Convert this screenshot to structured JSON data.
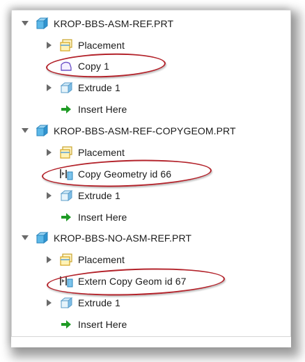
{
  "tree": {
    "parts": [
      {
        "name": "KROP-BBS-ASM-REF.PRT",
        "children": [
          {
            "label": "Placement",
            "icon": "placement-icon"
          },
          {
            "label": "Copy 1",
            "icon": "copy-icon"
          },
          {
            "label": "Extrude 1",
            "icon": "extrude-icon"
          },
          {
            "label": "Insert Here",
            "icon": "insert-here-arrow-icon"
          }
        ]
      },
      {
        "name": "KROP-BBS-ASM-REF-COPYGEOM.PRT",
        "children": [
          {
            "label": "Placement",
            "icon": "placement-icon"
          },
          {
            "label": "Copy Geometry id 66",
            "icon": "copy-geometry-icon"
          },
          {
            "label": "Extrude 1",
            "icon": "extrude-icon"
          },
          {
            "label": "Insert Here",
            "icon": "insert-here-arrow-icon"
          }
        ]
      },
      {
        "name": "KROP-BBS-NO-ASM-REF.PRT",
        "children": [
          {
            "label": "Placement",
            "icon": "placement-icon"
          },
          {
            "label": "Extern Copy Geom id 67",
            "icon": "copy-geometry-icon"
          },
          {
            "label": "Extrude 1",
            "icon": "extrude-icon"
          },
          {
            "label": "Insert Here",
            "icon": "insert-here-arrow-icon"
          }
        ]
      }
    ]
  },
  "highlight_color": "#b3222a",
  "part_icon_color": "#3aa7e0",
  "insert_arrow_color": "#1f9b25"
}
